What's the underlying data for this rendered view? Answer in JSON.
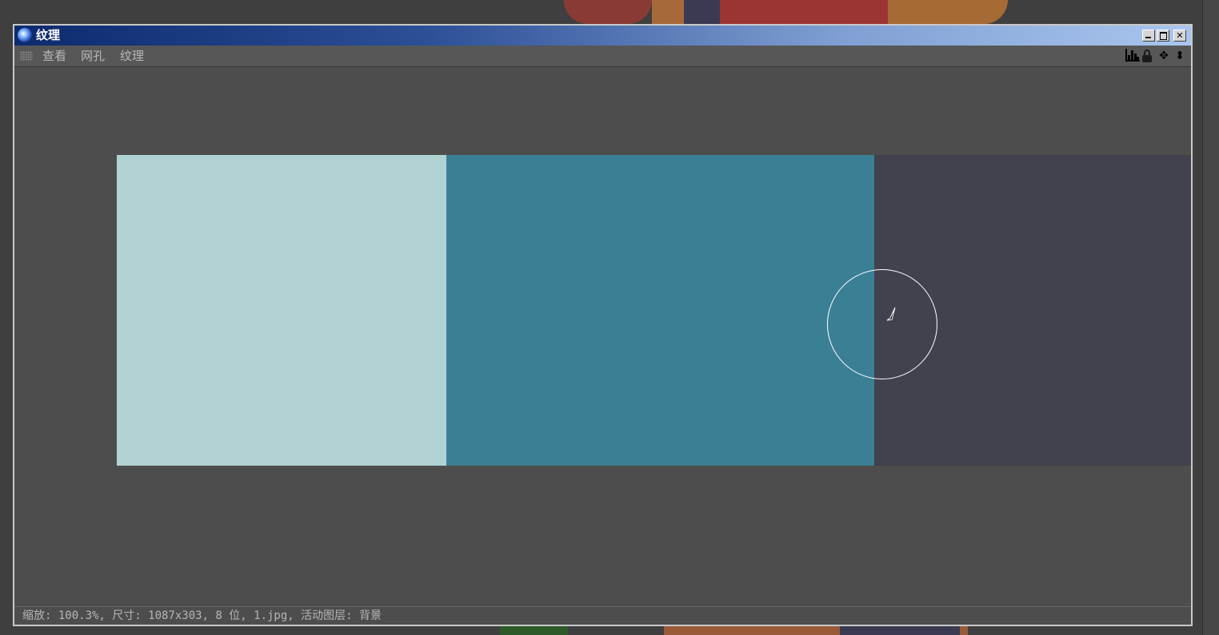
{
  "window": {
    "title": "纹理",
    "controls": {
      "minimize_icon": "minimize-icon",
      "maximize_icon": "maximize-icon",
      "close_icon": "close-icon",
      "close_glyph": "✕"
    }
  },
  "menubar": {
    "items": [
      {
        "label": "查看"
      },
      {
        "label": "网孔"
      },
      {
        "label": "纹理"
      }
    ],
    "tools": [
      {
        "icon": "histogram-icon"
      },
      {
        "icon": "lock-icon"
      },
      {
        "icon": "move-icon",
        "glyph": "✥"
      },
      {
        "icon": "up-down-arrows-icon",
        "glyph": "⬍"
      }
    ]
  },
  "texture": {
    "swatches": [
      {
        "color": "#b1d2d2"
      },
      {
        "color": "#3b7f95"
      },
      {
        "color": "#42414e"
      }
    ]
  },
  "status": {
    "text": "缩放: 100.3%, 尺寸: 1087x303, 8 位, 1.jpg, 活动图层: 背景"
  },
  "colors": {
    "title_gradient_start": "#0d2a6e",
    "title_gradient_end": "#a9c6ee",
    "panel_bg": "#4d4d4d"
  }
}
